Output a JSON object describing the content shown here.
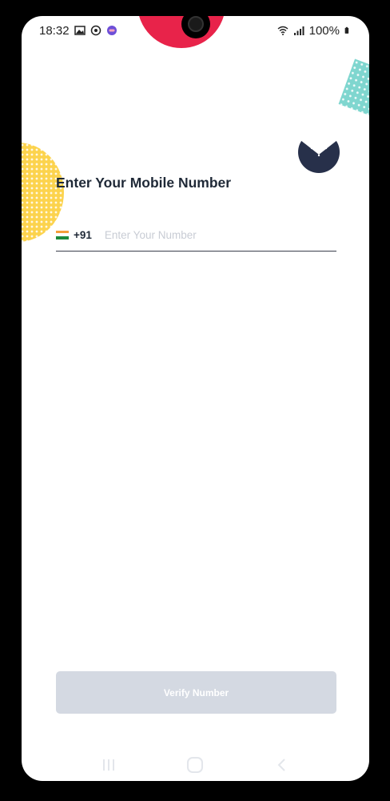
{
  "status_bar": {
    "time": "18:32",
    "battery": "100%",
    "icons": [
      "gallery-icon",
      "music-icon",
      "app-icon",
      "wifi-icon",
      "signal-icon",
      "battery-icon"
    ]
  },
  "colors": {
    "deco_red": "#e8234a",
    "deco_yellow": "#fcd34d",
    "deco_teal": "#7fd6cf",
    "logo_navy": "#27304a",
    "button_disabled": "#d4d9e2"
  },
  "form": {
    "title": "Enter Your Mobile Number",
    "country_flag": "india-flag-icon",
    "country_code": "+91",
    "number_value": "",
    "number_placeholder": "Enter Your Number"
  },
  "verify_button": {
    "label": "Verify Number",
    "enabled": false
  },
  "nav_bar": {
    "icons": [
      "recents-icon",
      "home-icon",
      "back-icon"
    ]
  }
}
